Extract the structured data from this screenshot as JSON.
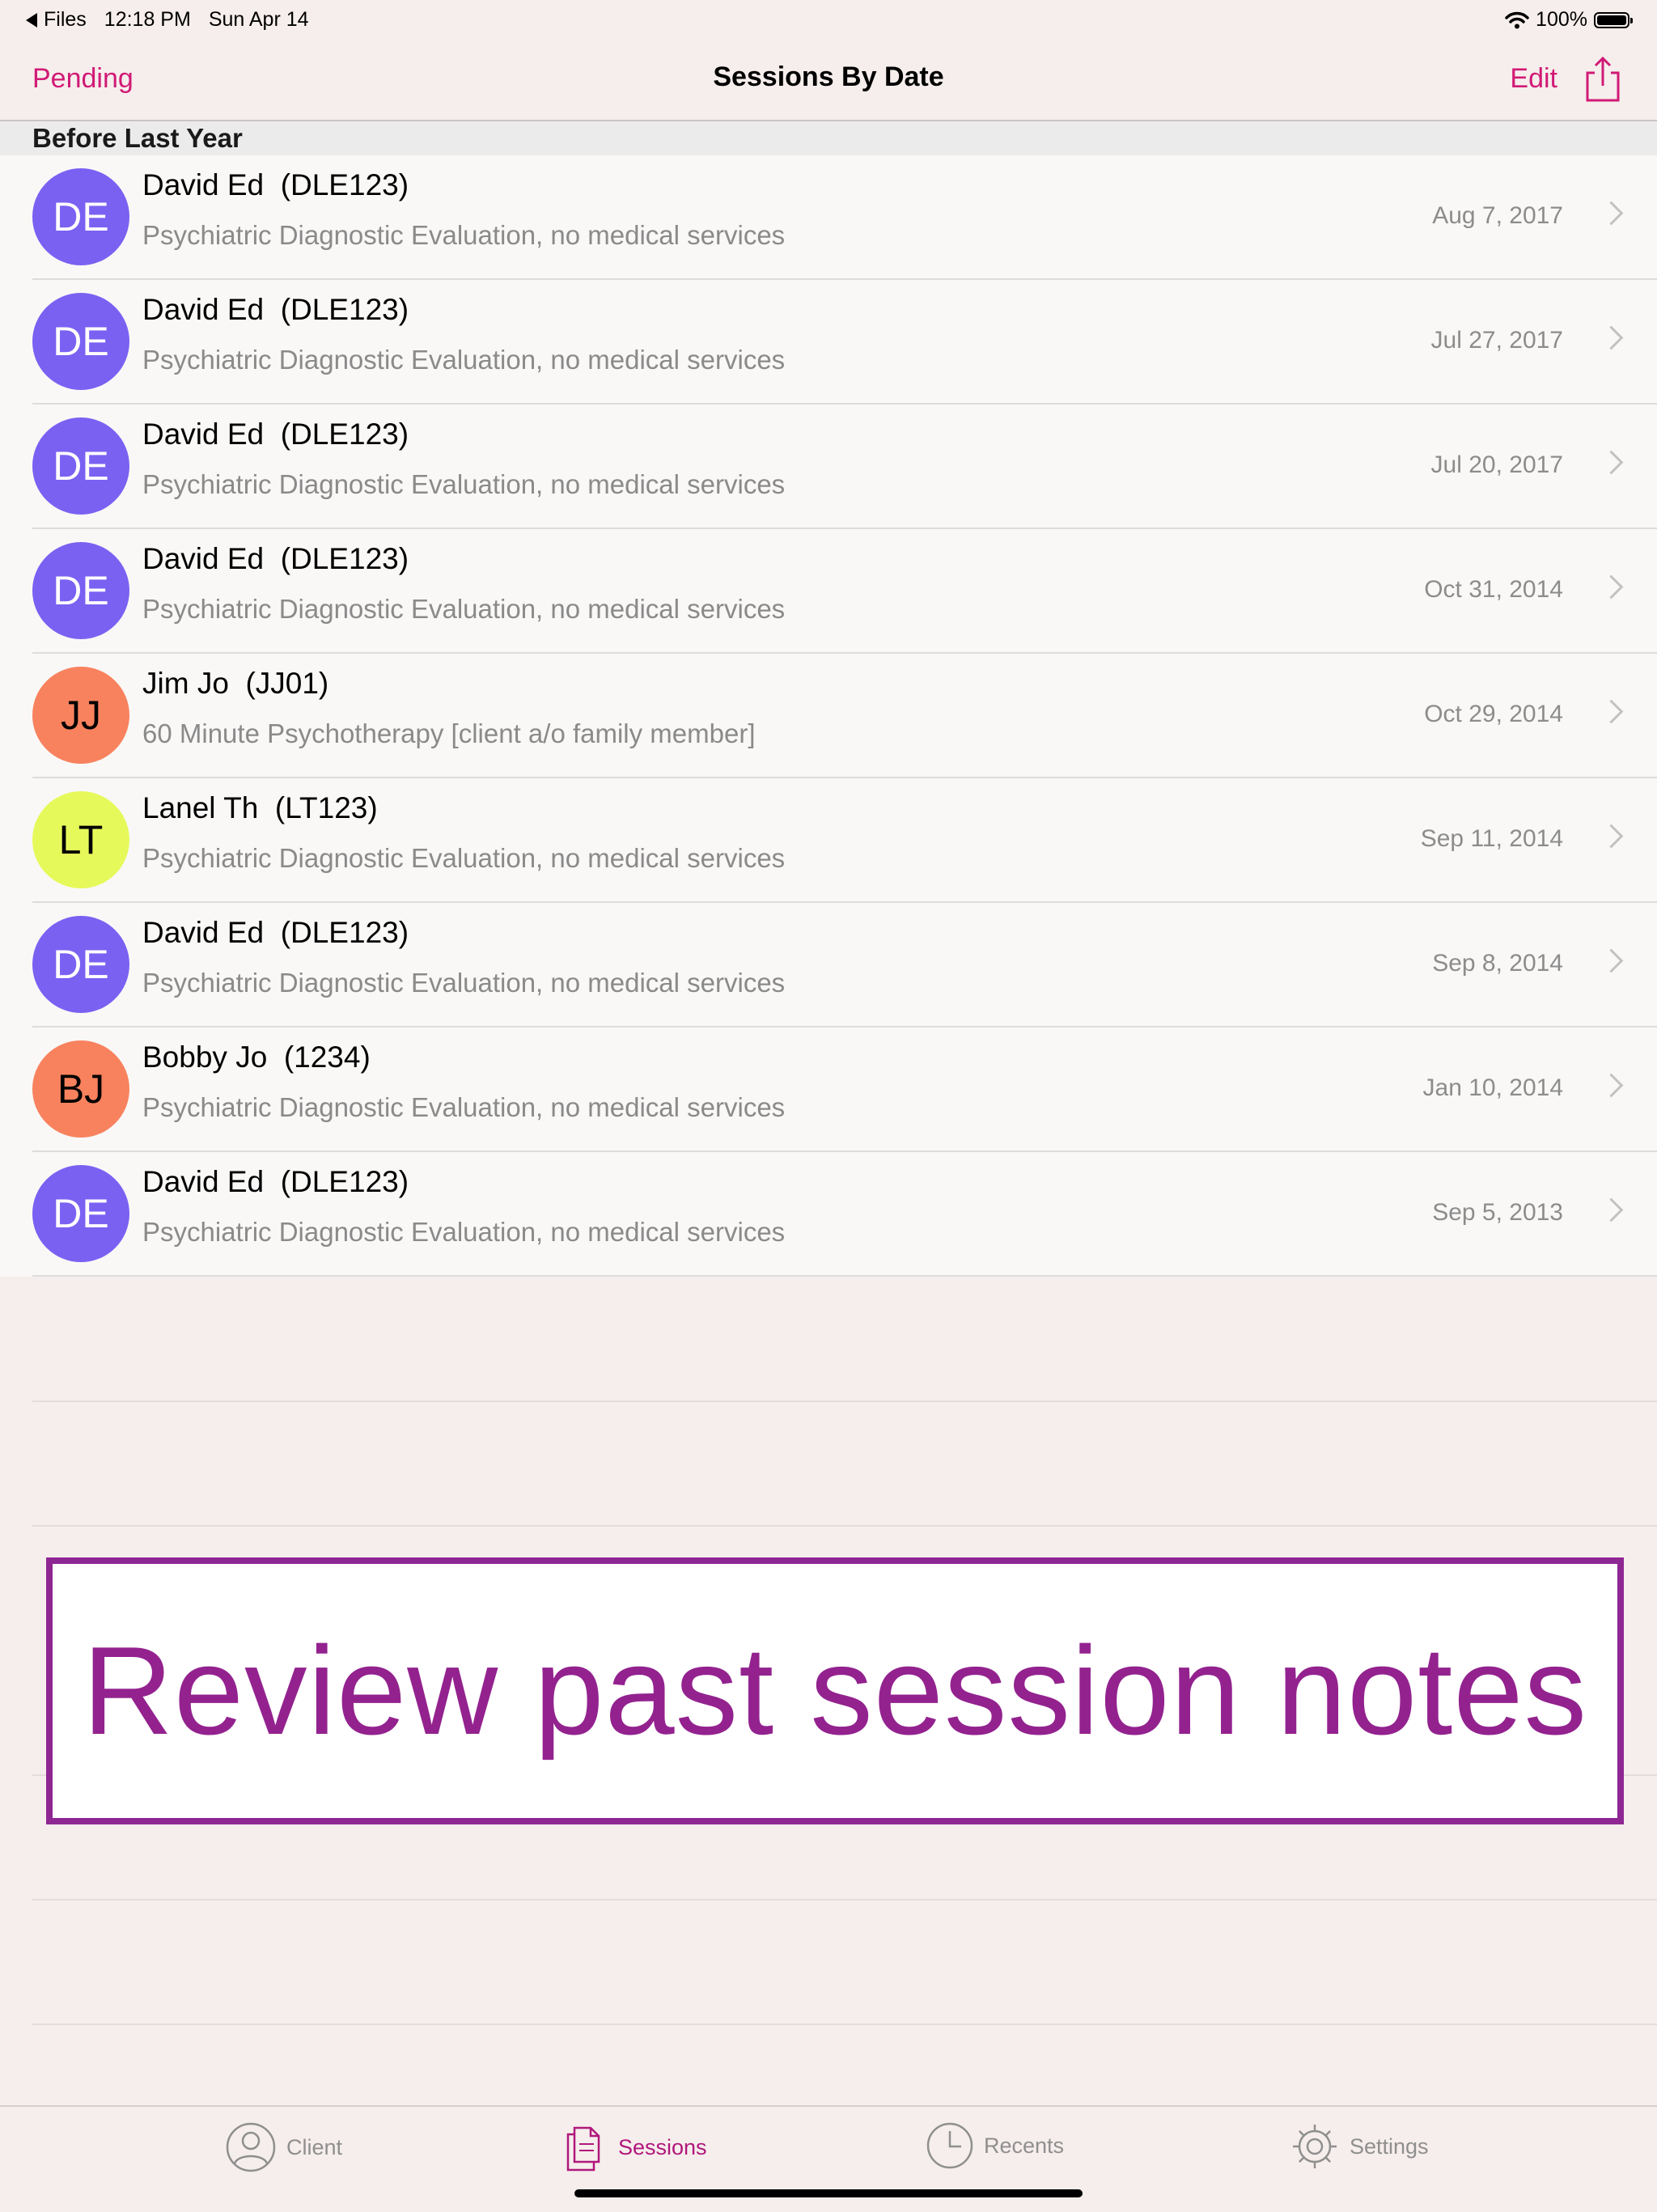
{
  "status_bar": {
    "back_app": "Files",
    "time": "12:18 PM",
    "date": "Sun Apr 14",
    "battery": "100%"
  },
  "nav": {
    "left_button": "Pending",
    "title": "Sessions By Date",
    "right_button": "Edit"
  },
  "section": {
    "title": "Before Last Year"
  },
  "sessions": [
    {
      "initials": "DE",
      "name": "David Ed  (DLE123)",
      "service": "Psychiatric Diagnostic Evaluation, no medical services",
      "date": "Aug 7, 2017",
      "color": "#7a61f2",
      "text_color": "#ffffff"
    },
    {
      "initials": "DE",
      "name": "David Ed  (DLE123)",
      "service": "Psychiatric Diagnostic Evaluation, no medical services",
      "date": "Jul 27, 2017",
      "color": "#7a61f2",
      "text_color": "#ffffff"
    },
    {
      "initials": "DE",
      "name": "David Ed  (DLE123)",
      "service": "Psychiatric Diagnostic Evaluation, no medical services",
      "date": "Jul 20, 2017",
      "color": "#7a61f2",
      "text_color": "#ffffff"
    },
    {
      "initials": "DE",
      "name": "David Ed  (DLE123)",
      "service": "Psychiatric Diagnostic Evaluation, no medical services",
      "date": "Oct 31, 2014",
      "color": "#7a61f2",
      "text_color": "#ffffff"
    },
    {
      "initials": "JJ",
      "name": "Jim Jo  (JJ01)",
      "service": "60 Minute Psychotherapy [client a/o family member]",
      "date": "Oct 29, 2014",
      "color": "#f8825e",
      "text_color": "#000000"
    },
    {
      "initials": "LT",
      "name": "Lanel Th  (LT123)",
      "service": "Psychiatric Diagnostic Evaluation, no medical services",
      "date": "Sep 11, 2014",
      "color": "#e6f95a",
      "text_color": "#000000"
    },
    {
      "initials": "DE",
      "name": "David Ed  (DLE123)",
      "service": "Psychiatric Diagnostic Evaluation, no medical services",
      "date": "Sep 8, 2014",
      "color": "#7a61f2",
      "text_color": "#ffffff"
    },
    {
      "initials": "BJ",
      "name": "Bobby Jo  (1234)",
      "service": "Psychiatric Diagnostic Evaluation, no medical services",
      "date": "Jan 10, 2014",
      "color": "#f8825e",
      "text_color": "#000000"
    },
    {
      "initials": "DE",
      "name": "David Ed  (DLE123)",
      "service": "Psychiatric Diagnostic Evaluation, no medical services",
      "date": "Sep 5, 2013",
      "color": "#7a61f2",
      "text_color": "#ffffff"
    }
  ],
  "banner": {
    "text": "Review past session notes",
    "color": "#93228f"
  },
  "tabs": [
    {
      "label": "Client",
      "icon": "person-circle-icon",
      "active": false
    },
    {
      "label": "Sessions",
      "icon": "documents-icon",
      "active": true
    },
    {
      "label": "Recents",
      "icon": "clock-icon",
      "active": false
    },
    {
      "label": "Settings",
      "icon": "gear-icon",
      "active": false
    }
  ],
  "colors": {
    "accent": "#d11a76",
    "tab_active": "#b0177c"
  }
}
